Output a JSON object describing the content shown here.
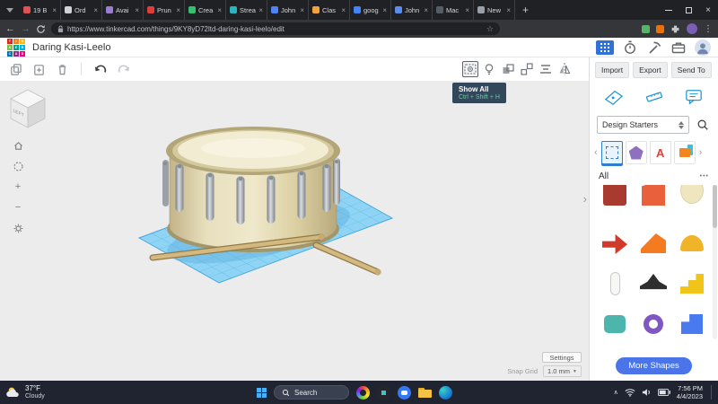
{
  "colors": {
    "accent_blue": "#3072d8",
    "workplane_blue": "#8fd4f4",
    "tooltip_bg": "#33475b",
    "tooltip_shortcut_text": "#5ecfa6",
    "more_shapes_button": "#4a74e8",
    "taskbar_bg": "#1f2430",
    "browser_chrome": "#202124"
  },
  "glyphs": {
    "plus": "+",
    "close": "×",
    "minus": "−",
    "back": "←",
    "forward": "→",
    "star": "☆",
    "kebab": "⋮",
    "chevron_left": "‹",
    "chevron_right": "›",
    "caret_down": "▼",
    "caret_up": "∧",
    "overflow": "•••"
  },
  "browser": {
    "tabs": [
      {
        "title": "19 B",
        "favicon": "#e05252"
      },
      {
        "title": "Ord",
        "favicon": "#cfd2d6"
      },
      {
        "title": "Avai",
        "favicon": "#9a7fd1"
      },
      {
        "title": "Prun",
        "favicon": "#e23b3b"
      },
      {
        "title": "Crea",
        "favicon": "#35c06f"
      },
      {
        "title": "Strea",
        "favicon": "#2bb3c0"
      },
      {
        "title": "John",
        "favicon": "#4f84f3"
      },
      {
        "title": "Clas",
        "favicon": "#f2a33c"
      },
      {
        "title": "goog",
        "favicon": "#4285f4"
      },
      {
        "title": "John",
        "favicon": "#5b8def"
      },
      {
        "title": "Mac",
        "favicon": "#565d66"
      },
      {
        "title": "New",
        "favicon": "#9aa0a6"
      }
    ],
    "url": "https://www.tinkercad.com/things/9KY8yD72ltd-daring-kasi-leelo/edit"
  },
  "header": {
    "logo_letters": [
      "T",
      "I",
      "N",
      "K",
      "E",
      "R",
      "C",
      "A",
      "D"
    ],
    "logo_colors": [
      "#e2231a",
      "#f5821f",
      "#fdb913",
      "#7ac143",
      "#00a78e",
      "#00aeef",
      "#0072bc",
      "#92278f",
      "#ec008c"
    ],
    "title": "Daring Kasi-Leelo"
  },
  "tooltip": {
    "title": "Show All",
    "shortcut": "Ctrl + Shift + H"
  },
  "panel": {
    "import_label": "Import",
    "export_label": "Export",
    "send_to_label": "Send To",
    "design_starters_label": "Design Starters",
    "starter_letter": "A",
    "carousel": {
      "pentagon": "#8e6fc0",
      "letter": "#d9453c",
      "box": "#f5861f",
      "sliver": "#39c2d7"
    },
    "section_label": "All",
    "more_shapes_label": "More Shapes",
    "shapes": [
      {
        "name": "maroon-shape",
        "color": "#a93a30"
      },
      {
        "name": "orange-shape",
        "color": "#e8603c"
      },
      {
        "name": "cream-shape",
        "color": "#efe6c0"
      },
      {
        "name": "red-arrow",
        "color": "#cf3a2b"
      },
      {
        "name": "orange-wedge",
        "color": "#f47b20"
      },
      {
        "name": "gold-dome",
        "color": "#f0b429"
      },
      {
        "name": "white-capsule",
        "color": "#f7f7f5"
      },
      {
        "name": "black-hat",
        "color": "#2e2e2e"
      },
      {
        "name": "yellow-stairs",
        "color": "#f0c419"
      },
      {
        "name": "teal-box",
        "color": "#4db6ac"
      },
      {
        "name": "purple-ring",
        "color": "#7e57c2"
      },
      {
        "name": "blue-puzzle",
        "color": "#4a7af0"
      }
    ]
  },
  "canvas": {
    "viewcube_label": "LEFT",
    "settings_label": "Settings",
    "snap_grid_label": "Snap Grid",
    "snap_grid_value": "1.0 mm"
  },
  "taskbar": {
    "weather_temp": "37°F",
    "weather_desc": "Cloudy",
    "search_placeholder": "Search",
    "time": "7:56 PM",
    "date": "4/4/2023"
  }
}
